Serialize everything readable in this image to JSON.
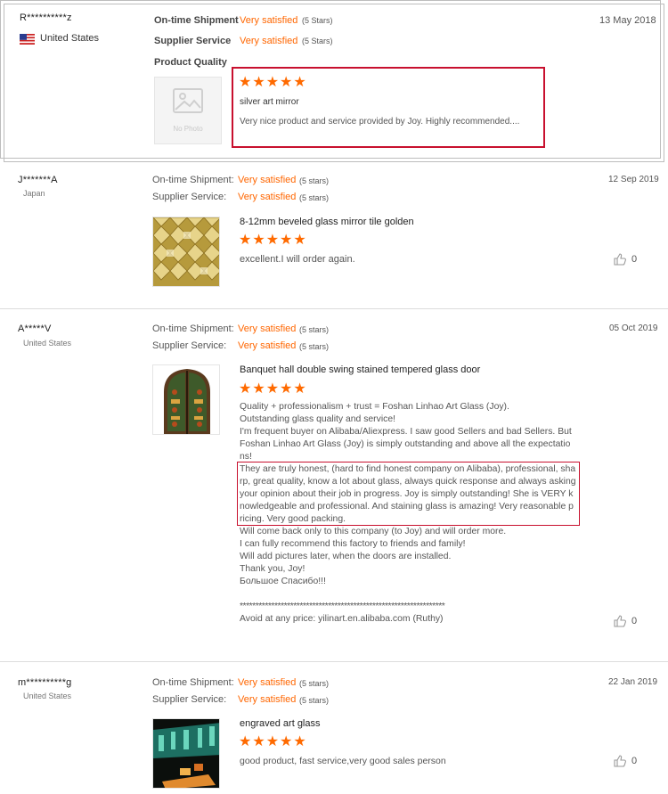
{
  "reviews": [
    {
      "author": "R**********z",
      "country": "United States",
      "date": "13 May 2018",
      "shipment_label": "On-time Shipment",
      "shipment_value": "Very satisfied",
      "shipment_stars": "(5 Stars)",
      "service_label": "Supplier Service",
      "service_value": "Very satisfied",
      "service_stars": "(5 Stars)",
      "quality_label": "Product Quality",
      "rating": "★★★★★",
      "product": "silver art mirror",
      "comment": "Very nice product and service provided by Joy. Highly recommended....",
      "photo_caption": "No Photo"
    },
    {
      "author": "J*******A",
      "country": "Japan",
      "date": "12 Sep 2019",
      "shipment_label": "On-time Shipment:",
      "shipment_value": "Very satisfied",
      "shipment_stars": "(5 stars)",
      "service_label": "Supplier Service:",
      "service_value": "Very satisfied",
      "service_stars": "(5 stars)",
      "product": "8-12mm beveled glass mirror tile golden",
      "rating": "★★★★★",
      "comment": "excellent.I will order again.",
      "likes": "0"
    },
    {
      "author": "A*****V",
      "country": "United States",
      "date": "05 Oct 2019",
      "shipment_label": "On-time Shipment:",
      "shipment_value": "Very satisfied",
      "shipment_stars": "(5 stars)",
      "service_label": "Supplier Service:",
      "service_value": "Very satisfied",
      "service_stars": "(5 stars)",
      "product": "Banquet hall double swing stained tempered glass door",
      "rating": "★★★★★",
      "comment_lines": [
        "Quality + professionalism + trust = Foshan Linhao Art Glass (Joy).",
        "Outstanding glass quality and service!",
        "I'm frequent buyer on Alibaba/Aliexpress. I saw good Sellers and bad Sellers. But",
        "Foshan Linhao Art Glass (Joy) is simply outstanding and above all the expectatio",
        "ns!",
        "They are truly honest, (hard to find honest company on Alibaba), professional, sha",
        "rp, great quality, know a lot about glass, always quick response and always asking",
        "your opinion about their job in progress. Joy is simply outstanding! She is VERY k",
        "nowledgeable and professional. And staining glass is amazing! Very reasonable p",
        "ricing. Very good packing.",
        "Will come back only to this company (to Joy) and will order more.",
        "I can fully recommend this factory to friends and family!",
        "Will add pictures later, when the doors are installed.",
        "Thank you, Joy!",
        "Большое Спасибо!!!",
        "",
        "*****************************************************************",
        "Avoid at any price: yilinart.en.alibaba.com (Ruthy)"
      ],
      "likes": "0"
    },
    {
      "author": "m**********g",
      "country": "United States",
      "date": "22 Jan 2019",
      "shipment_label": "On-time Shipment:",
      "shipment_value": "Very satisfied",
      "shipment_stars": "(5 stars)",
      "service_label": "Supplier Service:",
      "service_value": "Very satisfied",
      "service_stars": "(5 stars)",
      "product": "engraved art glass",
      "rating": "★★★★★",
      "comment": "good product, fast service,very good sales person",
      "likes": "0"
    }
  ],
  "colors": {
    "accent": "#ff6600",
    "highlight_box": "#c8102e"
  },
  "icons": [
    "us-flag-icon",
    "no-photo-icon",
    "thumbs-up-icon"
  ]
}
